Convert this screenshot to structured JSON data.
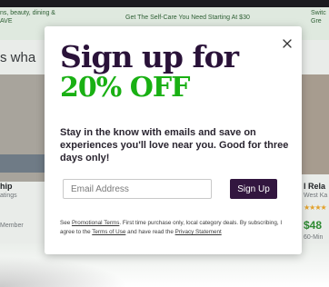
{
  "background": {
    "nav_left": "ns, beauty, dining &\nAVE",
    "nav_mid": "Get The Self-Care You Need Starting At $30",
    "nav_right": "Switc\nGre",
    "heading": "s wha",
    "left_card": {
      "title": "hip",
      "subtitle": "atings",
      "member": "Member"
    },
    "right_card": {
      "title": "l Rela",
      "subtitle": "West Ka",
      "stars": "★★★★",
      "price": "$48",
      "note": "60-Min"
    }
  },
  "modal": {
    "headline_line1": "Sign up for",
    "headline_line2": "20% OFF",
    "body": "Stay in the know with emails and save on experiences you'll love near you. Good for three days only!",
    "email_placeholder": "Email Address",
    "email_value": "",
    "signup_label": "Sign Up",
    "close_label": "×",
    "fineprint": {
      "see": "See ",
      "promo_link": "Promotional Terms",
      "text1": ". First time purchase only, local category deals. By subscribing, I agree to the ",
      "terms_link": "Terms of Use",
      "text2": " and have read the ",
      "privacy_link": "Privacy Statement"
    }
  },
  "colors": {
    "headline_purple": "#2a1239",
    "headline_green": "#19b013",
    "button_bg": "#32163f",
    "nav_bg": "#dfe9df"
  },
  "icons": {
    "close": "close-icon"
  }
}
